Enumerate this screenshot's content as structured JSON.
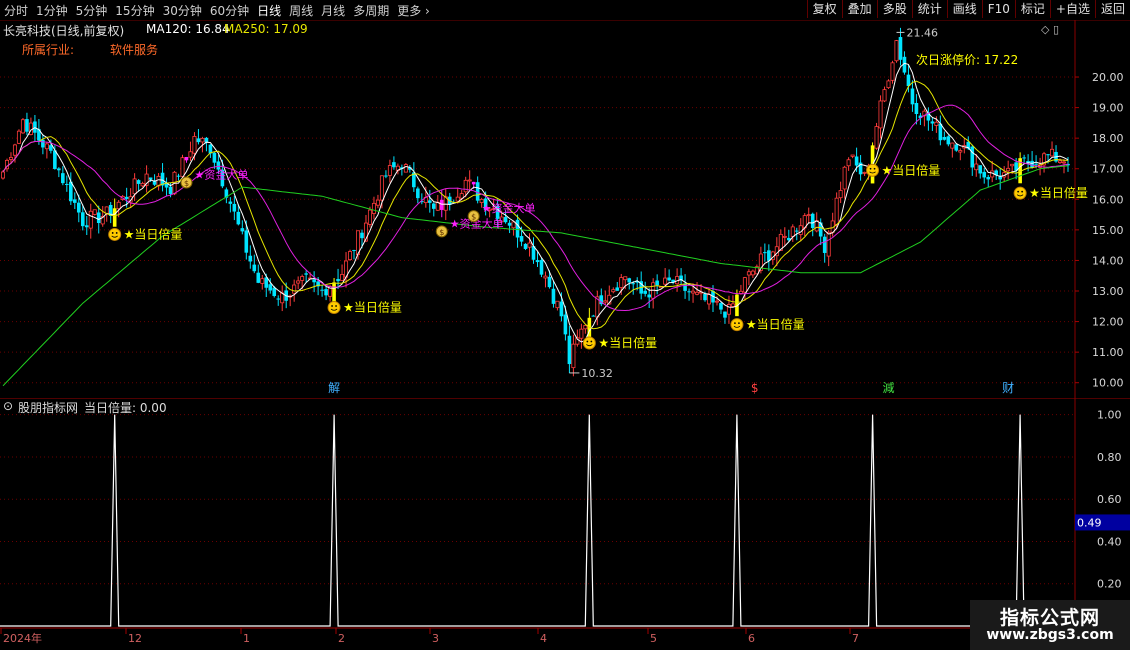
{
  "toolbar": {
    "periods": [
      "分时",
      "1分钟",
      "5分钟",
      "15分钟",
      "30分钟",
      "60分钟",
      "日线",
      "周线",
      "月线",
      "多周期",
      "更多"
    ],
    "active_period": "日线",
    "buttons": [
      "复权",
      "叠加",
      "多股",
      "统计",
      "画线",
      "F10",
      "标记",
      "+自选",
      "返回"
    ]
  },
  "header": {
    "stock_title": "长亮科技(日线,前复权)",
    "ma120_label": "MA120: 16.84",
    "ma250_label": "MA250: 17.09",
    "industry_label": "所属行业:",
    "industry_value": "软件服务",
    "limit_up_text": "次日涨停价: 17.22"
  },
  "colors": {
    "up": "#ff3c3c",
    "down": "#00e4ff",
    "ma1": "#ffffff",
    "ma2": "#e6e600",
    "ma3": "#e020e0",
    "ma4": "#20d020",
    "label": "#ffff00",
    "grid": "#6a0000",
    "indicator": "#ffffff",
    "magenta_bar": "#ff20ff"
  },
  "indicator_header": {
    "name": "股朋指标网",
    "series": "当日倍量: 0.00"
  },
  "chart_data": [
    {
      "type": "candlestick",
      "price_axis": {
        "ticks": [
          20.0,
          19.0,
          18.0,
          17.0,
          16.0,
          15.0,
          14.0,
          13.0,
          12.0,
          11.0,
          10.0
        ],
        "tick_labels": [
          "20.00",
          "19.00",
          "18.00",
          "17.00",
          "16.00",
          "15.00",
          "14.00",
          "13.00",
          "12.00",
          "11.00",
          "10.00"
        ],
        "range": [
          9.5,
          21.8
        ]
      },
      "annotations": {
        "high": "21.46",
        "low": "10.32"
      },
      "signals": [
        {
          "text": "★当日倍量",
          "date_index": 28
        },
        {
          "text": "★当日倍量",
          "date_index": 83
        },
        {
          "text": "★当日倍量",
          "date_index": 147
        },
        {
          "text": "★当日倍量",
          "date_index": 184
        },
        {
          "text": "★当日倍量",
          "date_index": 218
        },
        {
          "text": "★当日倍量",
          "date_index": 255
        }
      ],
      "capital_signals": [
        {
          "text": "★资金大单",
          "date_index": 46
        },
        {
          "text": "★资金大单",
          "date_index": 110
        },
        {
          "text": "★资金大单",
          "date_index": 118
        }
      ],
      "event_markers": [
        {
          "text": "解",
          "date_index": 83
        },
        {
          "text": "$",
          "date_index": 189
        },
        {
          "text": "減",
          "date_index": 222
        },
        {
          "text": "财",
          "date_index": 252
        }
      ],
      "x_axis_labels": [
        "2024年",
        "12",
        "1",
        "2",
        "3",
        "4",
        "5",
        "6",
        "7"
      ],
      "keypoints": [
        [
          0,
          16.9
        ],
        [
          5,
          18.6
        ],
        [
          12,
          17.5
        ],
        [
          20,
          15.3
        ],
        [
          26,
          15.5
        ],
        [
          30,
          16.0
        ],
        [
          36,
          16.8
        ],
        [
          42,
          16.4
        ],
        [
          46,
          17.4
        ],
        [
          48,
          18.0
        ],
        [
          52,
          17.7
        ],
        [
          56,
          16.3
        ],
        [
          60,
          14.7
        ],
        [
          64,
          13.3
        ],
        [
          70,
          12.8
        ],
        [
          76,
          13.3
        ],
        [
          80,
          13.0
        ],
        [
          85,
          13.6
        ],
        [
          90,
          15.0
        ],
        [
          96,
          16.8
        ],
        [
          100,
          17.2
        ],
        [
          104,
          16.3
        ],
        [
          108,
          15.6
        ],
        [
          112,
          16.0
        ],
        [
          116,
          16.6
        ],
        [
          120,
          16.0
        ],
        [
          126,
          15.4
        ],
        [
          132,
          14.5
        ],
        [
          136,
          13.5
        ],
        [
          140,
          12.2
        ],
        [
          142,
          10.7
        ],
        [
          146,
          12.0
        ],
        [
          150,
          12.8
        ],
        [
          156,
          13.5
        ],
        [
          160,
          12.9
        ],
        [
          168,
          13.3
        ],
        [
          174,
          12.8
        ],
        [
          182,
          12.3
        ],
        [
          186,
          13.3
        ],
        [
          190,
          14.0
        ],
        [
          196,
          14.7
        ],
        [
          202,
          15.6
        ],
        [
          206,
          14.5
        ],
        [
          212,
          17.4
        ],
        [
          216,
          16.7
        ],
        [
          220,
          19.0
        ],
        [
          224,
          21.2
        ],
        [
          228,
          19.2
        ],
        [
          232,
          18.6
        ],
        [
          236,
          18.0
        ],
        [
          240,
          17.8
        ],
        [
          246,
          16.8
        ],
        [
          252,
          16.8
        ],
        [
          256,
          17.2
        ],
        [
          262,
          17.4
        ],
        [
          267,
          17.3
        ]
      ],
      "moving_averages": [
        {
          "name": "MA120",
          "value": 16.84
        },
        {
          "name": "MA250",
          "value": 17.09
        }
      ]
    },
    {
      "type": "spike",
      "series": "当日倍量",
      "y_axis": {
        "ticks": [
          1.0,
          0.8,
          0.6,
          0.4,
          0.2
        ],
        "tick_labels": [
          "1.00",
          "0.80",
          "0.60",
          "0.40",
          "0.20"
        ],
        "range": [
          0,
          1.06
        ]
      },
      "cursor_value": "0.49",
      "spikes_at": [
        28,
        83,
        147,
        184,
        218,
        255
      ],
      "values": "1 at spikes, 0 elsewhere"
    }
  ],
  "logo": {
    "title": "指标公式网",
    "url": "www.zbgs3.com"
  }
}
